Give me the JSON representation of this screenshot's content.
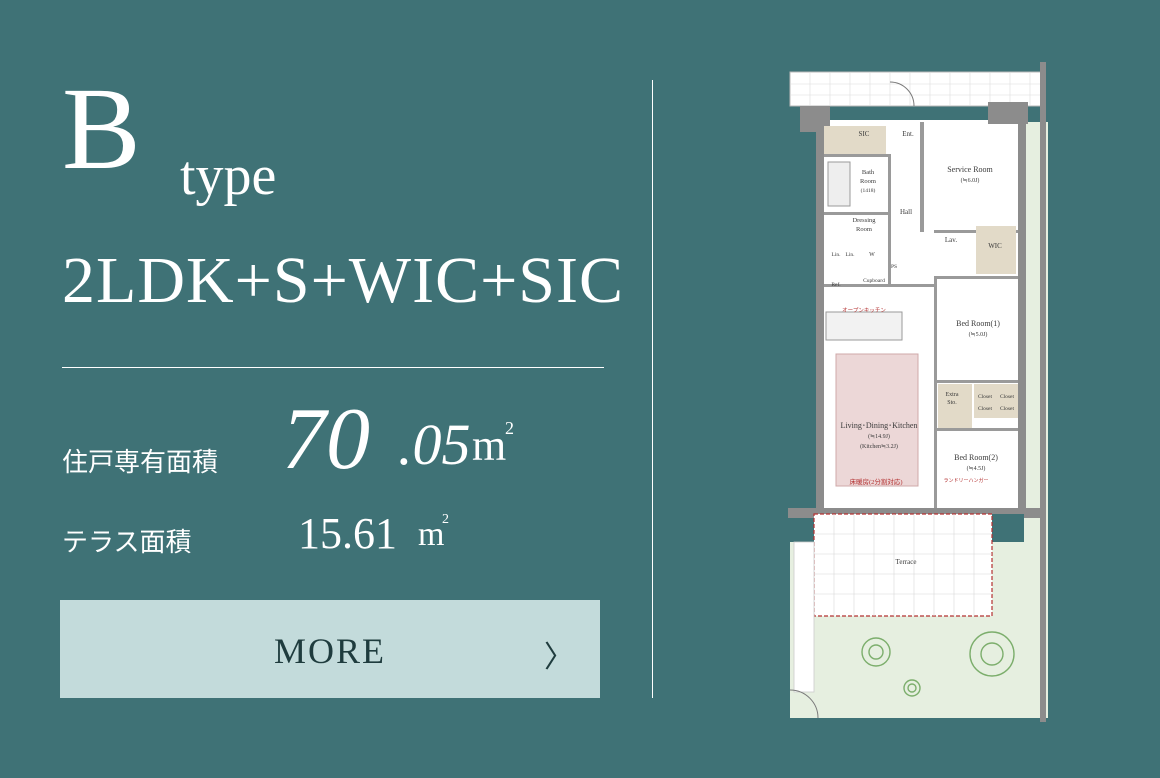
{
  "heading": {
    "type_letter": "B",
    "type_word": "type",
    "layout_code": "2LDK+S+WIC+SIC"
  },
  "areas": {
    "dwelling_label": "住戸専有面積",
    "dwelling_int": "70",
    "dwelling_dec": ".05",
    "dwelling_unit": "m",
    "dwelling_unit_sup": "2",
    "terrace_label": "テラス面積",
    "terrace_value": "15.61",
    "terrace_unit": "m",
    "terrace_unit_sup": "2"
  },
  "more_button": {
    "label": "MORE",
    "chevron": "〉"
  },
  "floor_plan": {
    "rooms": {
      "sic": "SIC",
      "ent": "Ent.",
      "bath_1": "Bath",
      "bath_2": "Room",
      "bath_3": "(1418)",
      "service_room": "Service Room",
      "service_area": "(≒6.0J)",
      "hall": "Hall",
      "dressing_1": "Dressing",
      "dressing_2": "Room",
      "lav": "Lav.",
      "wic": "WIC",
      "w": "W",
      "lin1": "Lin.",
      "lin2": "Lin.",
      "ps": "PS",
      "ref": "Ref.",
      "cupboard": "Cupboard",
      "open_kitchen": "オープンキッチン",
      "bed1": "Bed Room(1)",
      "bed1_area": "(≒5.0J)",
      "extra_1": "Extra",
      "extra_2": "Sto.",
      "closet": "Closet",
      "ldk": "Living･Dining･Kitchen",
      "ldk_area": "(≒14.9J)",
      "kitchen_area": "(Kitchen≒3.2J)",
      "floor_heating": "床暖房(2分割対応)",
      "bed2": "Bed Room(2)",
      "bed2_area": "(≒4.5J)",
      "laundry": "ランドリーハンガー",
      "terrace": "Terrace"
    },
    "colors": {
      "wall": "#8c8c8c",
      "room": "#ffffff",
      "garden": "#e6efe0",
      "heating": "#ecd7d7",
      "accent_red": "#b33030",
      "storage": "#e2dac8"
    }
  }
}
